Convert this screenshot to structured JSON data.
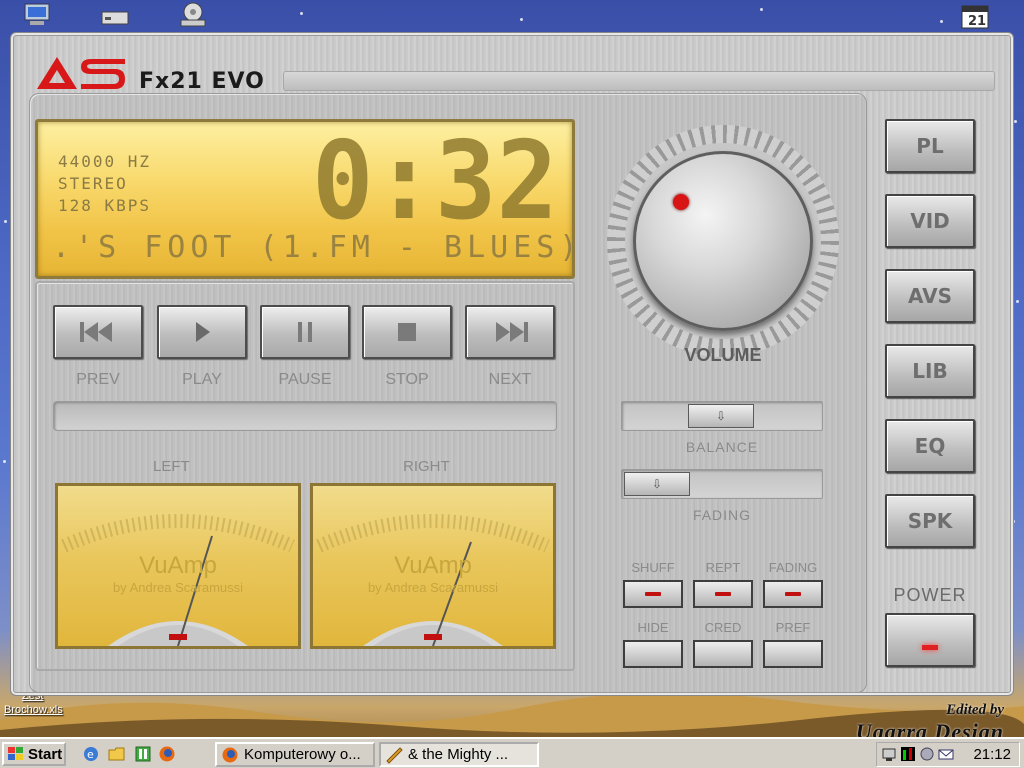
{
  "desktop": {
    "file_label_1": "Brochow.xls",
    "file_label_2": "Zest",
    "watermark_line1": "Edited by",
    "watermark_line2": "Ugarra Design"
  },
  "player": {
    "logo": "AS",
    "title": "Fx21 EVO",
    "display": {
      "samplerate": "44000 HZ",
      "channels": "STEREO",
      "bitrate": "128 KBPS",
      "time": "0:32",
      "song": ".'S FOOT (1.FM - BLUES)"
    },
    "transport": {
      "prev": "PREV",
      "play": "PLAY",
      "pause": "PAUSE",
      "stop": "STOP",
      "next": "NEXT"
    },
    "meters": {
      "left_label": "LEFT",
      "right_label": "RIGHT",
      "brand": "VuAmp",
      "author": "by Andrea Scaramussi"
    },
    "volume_label": "VOLUME",
    "balance_label": "BALANCE",
    "fading_label": "FADING",
    "small_buttons": {
      "shuff": "SHUFF",
      "rept": "REPT",
      "fading": "FADING",
      "hide": "HIDE",
      "cred": "CRED",
      "pref": "PREF"
    },
    "side_buttons": {
      "pl": "PL",
      "vid": "VID",
      "avs": "AVS",
      "lib": "LIB",
      "eq": "EQ",
      "spk": "SPK"
    },
    "power_label": "POWER",
    "accent_color": "#d91414",
    "lcd_color": "#f5d061"
  },
  "taskbar": {
    "start": "Start",
    "task1": "Komputerowy o...",
    "task2": "& the Mighty ...",
    "clock": "21:12"
  }
}
